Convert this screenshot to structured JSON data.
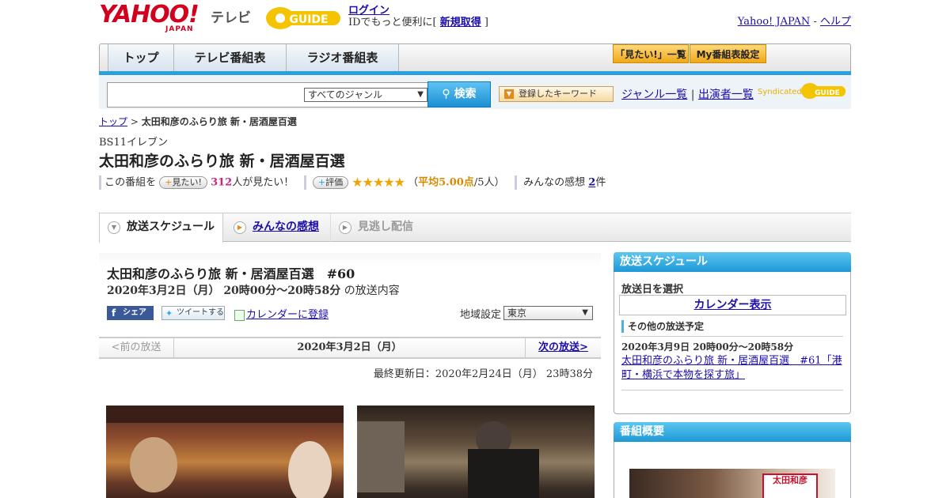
{
  "header": {
    "logo_yahoo": "YAHOO!",
    "logo_japan": "JAPAN",
    "logo_tv": "テレビ",
    "logo_gguide": "GUIDE",
    "login_label": "ログイン",
    "id_text_prefix": "IDでもっと便利に[ ",
    "register_label": "新規取得",
    "id_text_suffix": " ]",
    "yahoo_japan_link": "Yahoo! JAPAN",
    "separator": " - ",
    "help_link": "ヘルプ"
  },
  "nav": {
    "tabs": [
      {
        "label": "トップ"
      },
      {
        "label": "テレビ番組表"
      },
      {
        "label": "ラジオ番組表"
      }
    ],
    "mitai_list": "「見たい!」一覧",
    "my_guide": "My番組表設定"
  },
  "search": {
    "input_value": "",
    "genre_selected": "すべてのジャンル",
    "search_button": "検索",
    "keyword_button": "登録したキーワード",
    "genre_list_link": "ジャンル一覧",
    "link_separator": " | ",
    "cast_list_link": "出演者一覧",
    "syndicated": "Syndicated",
    "syndicated_logo": "GUIDE"
  },
  "breadcrumb": {
    "top": "トップ",
    "arrow": " > ",
    "current": "太田和彦のふらり旅 新・居酒屋百選"
  },
  "program": {
    "channel": "BS11イレブン",
    "title": "太田和彦のふらり旅 新・居酒屋百選",
    "this_program": "この番組を",
    "mitai_button": "見たい!",
    "mitai_count": "312",
    "mitai_suffix": "人が見たい！",
    "rating_button": "評価",
    "stars": "★★★★★",
    "rating_prefix": "（",
    "rating_avg": "平均5.00点",
    "rating_suffix": "/5人）",
    "impressions_label": "みんなの感想 ",
    "impressions_count": "2",
    "impressions_suffix": "件"
  },
  "tabs": {
    "schedule": "放送スケジュール",
    "impressions": "みんなの感想",
    "streaming": "見逃し配信"
  },
  "episode": {
    "title": "太田和彦のふらり旅 新・居酒屋百選　#60",
    "datetime": "2020年3月2日（月） 20時00分～20時58分",
    "datetime_suffix": " の放送内容",
    "facebook_share": "シェア",
    "tweet": "ツイートする",
    "calendar_register": "カレンダーに登録",
    "region_label": "地域設定",
    "region_selected": "東京",
    "prev": "<前の放送",
    "current_date": "2020年3月2日（月）",
    "next": "次の放送>",
    "last_updated": "最終更新日：2020年2月24日（月） 23時38分"
  },
  "sidebar": {
    "schedule_head": "放送スケジュール",
    "select_date": "放送日を選択",
    "calendar_display": "カレンダー表示",
    "other_schedule": "その他の放送予定",
    "other_date": "2020年3月9日 20時00分～20時58分",
    "other_link": "太田和彦のふらり旅 新・居酒屋百選　#61「港町・横浜で本物を探す旅」",
    "summary_head": "番組概要",
    "summary_image_text": "太田和彦"
  },
  "colors": {
    "accent_blue": "#2aa0dc",
    "brand_red": "#d1001f",
    "gguide_yellow": "#f5c400",
    "count_pink": "#d6207c",
    "star_orange": "#f0a400"
  }
}
